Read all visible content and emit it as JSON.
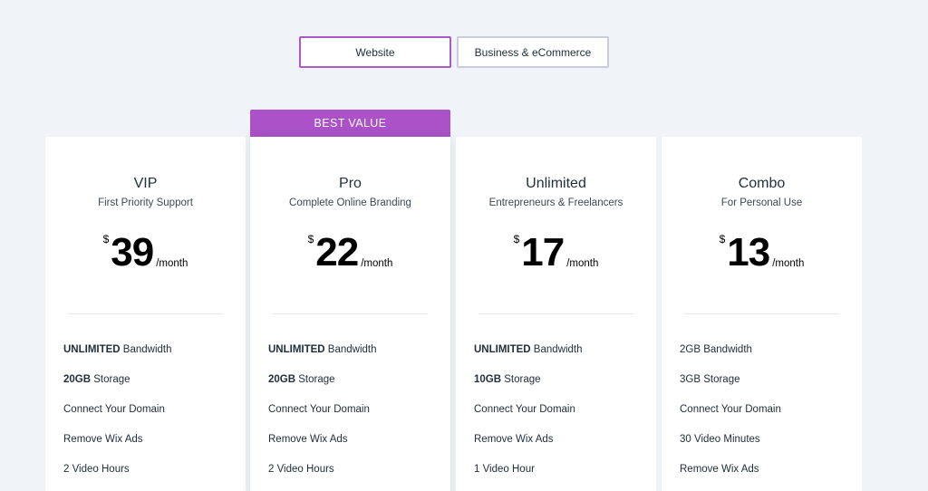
{
  "tabs": [
    {
      "label": "Website",
      "active": true
    },
    {
      "label": "Business & eCommerce",
      "active": false
    }
  ],
  "badge": "BEST VALUE",
  "currency": "$",
  "period": "/month",
  "colors": {
    "accent": "#ab52c8",
    "background": "#f0f3f7"
  },
  "plans": [
    {
      "name": "VIP",
      "tagline": "First Priority Support",
      "price": "39",
      "features": [
        {
          "bold": "UNLIMITED",
          "text": " Bandwidth"
        },
        {
          "bold": "20GB",
          "text": " Storage"
        },
        {
          "bold": "",
          "text": "Connect Your Domain"
        },
        {
          "bold": "",
          "text": "Remove Wix Ads"
        },
        {
          "bold": "",
          "text": "2 Video Hours"
        }
      ]
    },
    {
      "name": "Pro",
      "tagline": "Complete Online Branding",
      "price": "22",
      "features": [
        {
          "bold": "UNLIMITED",
          "text": " Bandwidth"
        },
        {
          "bold": "20GB",
          "text": " Storage"
        },
        {
          "bold": "",
          "text": "Connect Your Domain"
        },
        {
          "bold": "",
          "text": "Remove Wix Ads"
        },
        {
          "bold": "",
          "text": "2 Video Hours"
        }
      ]
    },
    {
      "name": "Unlimited",
      "tagline": "Entrepreneurs & Freelancers",
      "price": "17",
      "features": [
        {
          "bold": "UNLIMITED",
          "text": " Bandwidth"
        },
        {
          "bold": "10GB",
          "text": " Storage"
        },
        {
          "bold": "",
          "text": "Connect Your Domain"
        },
        {
          "bold": "",
          "text": "Remove Wix Ads"
        },
        {
          "bold": "",
          "text": "1 Video Hour"
        }
      ]
    },
    {
      "name": "Combo",
      "tagline": "For Personal Use",
      "price": "13",
      "features": [
        {
          "bold": "",
          "text": "2GB Bandwidth"
        },
        {
          "bold": "",
          "text": "3GB Storage"
        },
        {
          "bold": "",
          "text": "Connect Your Domain"
        },
        {
          "bold": "",
          "text": "30 Video Minutes"
        },
        {
          "bold": "",
          "text": "Remove Wix Ads"
        }
      ]
    }
  ]
}
